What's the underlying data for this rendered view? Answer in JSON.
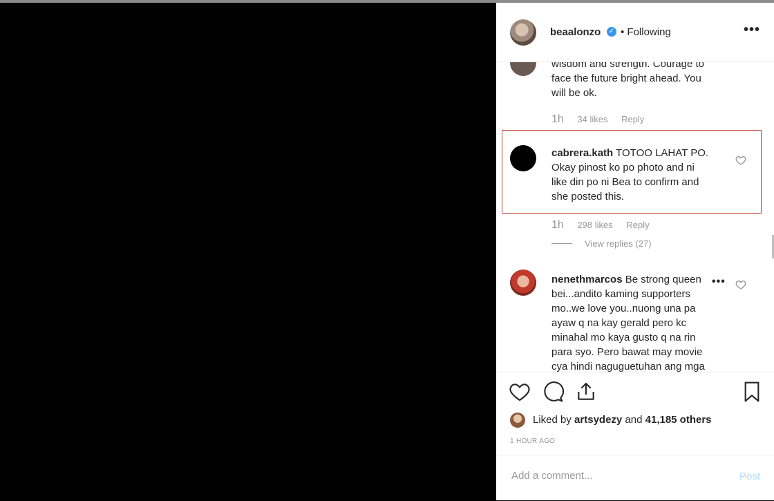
{
  "header": {
    "owner": "beaalonzo",
    "verified_mark": "✓",
    "follow_status": "• Following",
    "more_label": "•••"
  },
  "comments": {
    "partial": {
      "lines": [
        "wisdom and strength. Courage to",
        "face the future bright ahead. You",
        "will be ok."
      ],
      "time": "1h",
      "likes": "34 likes",
      "reply": "Reply"
    },
    "highlighted": {
      "user": "cabrera.kath",
      "text_line1": " TOTOO LAHAT PO.",
      "lines": [
        "Okay pinost ko po photo and ni",
        "like din po ni Bea to confirm and",
        "she posted this."
      ],
      "time": "1h",
      "likes": "298 likes",
      "reply": "Reply",
      "view_replies": "View replies (27)"
    },
    "neneth": {
      "user": "nenethmarcos",
      "text_line1": " Be strong queen",
      "lines": [
        "bei...andito kaming supporters",
        "mo..we love you..nuong una pa",
        "ayaw q na kay gerald pero kc",
        "minahal mo kaya gusto q na rin",
        "para syo. Pero bawat may movie",
        "cya hindi naguguetuhan ang mga"
      ],
      "more": "•••"
    }
  },
  "actions": {
    "icons": [
      "heart-icon",
      "comment-icon",
      "share-icon",
      "bookmark-icon"
    ],
    "liked_prefix": "Liked by ",
    "liker": "artsydezy",
    "liked_mid": " and ",
    "count": "41,185 others",
    "time_ago": "1 HOUR AGO"
  },
  "add_comment": {
    "placeholder": "Add a comment...",
    "post_label": "Post"
  },
  "colors": {
    "highlight_border": "#c0392b",
    "verified": "#3897f0",
    "post_disabled": "#b3dbff"
  }
}
